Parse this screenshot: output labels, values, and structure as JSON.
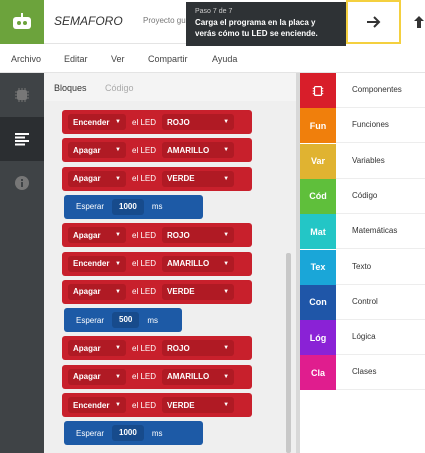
{
  "header": {
    "project_name": "SEMAFORO",
    "project_sub": "Proyecto gu",
    "tooltip_step": "Paso 7 de 7",
    "tooltip_msg": "Carga el programa en la placa y verás cómo tu LED se enciende."
  },
  "menu": [
    "Archivo",
    "Editar",
    "Ver",
    "Compartir",
    "Ayuda"
  ],
  "workspace_tabs": {
    "blocks": "Bloques",
    "code": "Código"
  },
  "blocks": [
    {
      "kind": "led",
      "action": "Encender",
      "label": "el LED",
      "color": "ROJO"
    },
    {
      "kind": "led",
      "action": "Apagar",
      "label": "el LED",
      "color": "AMARILLO"
    },
    {
      "kind": "led",
      "action": "Apagar",
      "label": "el LED",
      "color": "VERDE"
    },
    {
      "kind": "wait",
      "label": "Esperar",
      "value": "1000",
      "unit": "ms"
    },
    {
      "kind": "led",
      "action": "Apagar",
      "label": "el LED",
      "color": "ROJO"
    },
    {
      "kind": "led",
      "action": "Encender",
      "label": "el LED",
      "color": "AMARILLO"
    },
    {
      "kind": "led",
      "action": "Apagar",
      "label": "el LED",
      "color": "VERDE"
    },
    {
      "kind": "wait",
      "label": "Esperar",
      "value": "500",
      "unit": "ms"
    },
    {
      "kind": "led",
      "action": "Apagar",
      "label": "el LED",
      "color": "ROJO"
    },
    {
      "kind": "led",
      "action": "Apagar",
      "label": "el LED",
      "color": "AMARILLO"
    },
    {
      "kind": "led",
      "action": "Encender",
      "label": "el LED",
      "color": "VERDE"
    },
    {
      "kind": "wait",
      "label": "Esperar",
      "value": "1000",
      "unit": "ms"
    }
  ],
  "toolbox": [
    {
      "chip": "",
      "label": "Componentes",
      "color": "#d81e2a",
      "icon": "chip-icon"
    },
    {
      "chip": "Fun",
      "label": "Funciones",
      "color": "#f07f0c"
    },
    {
      "chip": "Var",
      "label": "Variables",
      "color": "#e0b331"
    },
    {
      "chip": "Cód",
      "label": "Código",
      "color": "#5fbf3b"
    },
    {
      "chip": "Mat",
      "label": "Matemáticas",
      "color": "#23c6c6"
    },
    {
      "chip": "Tex",
      "label": "Texto",
      "color": "#1aa6d8"
    },
    {
      "chip": "Con",
      "label": "Control",
      "color": "#1f56a8"
    },
    {
      "chip": "Lóg",
      "label": "Lógica",
      "color": "#8a22d6"
    },
    {
      "chip": "Cla",
      "label": "Clases",
      "color": "#e01d8e"
    }
  ],
  "colors": {
    "brand": "#6ca33c",
    "block_red": "#c8202c",
    "block_blue": "#1d5aa6",
    "highlight": "#f4d03f"
  }
}
